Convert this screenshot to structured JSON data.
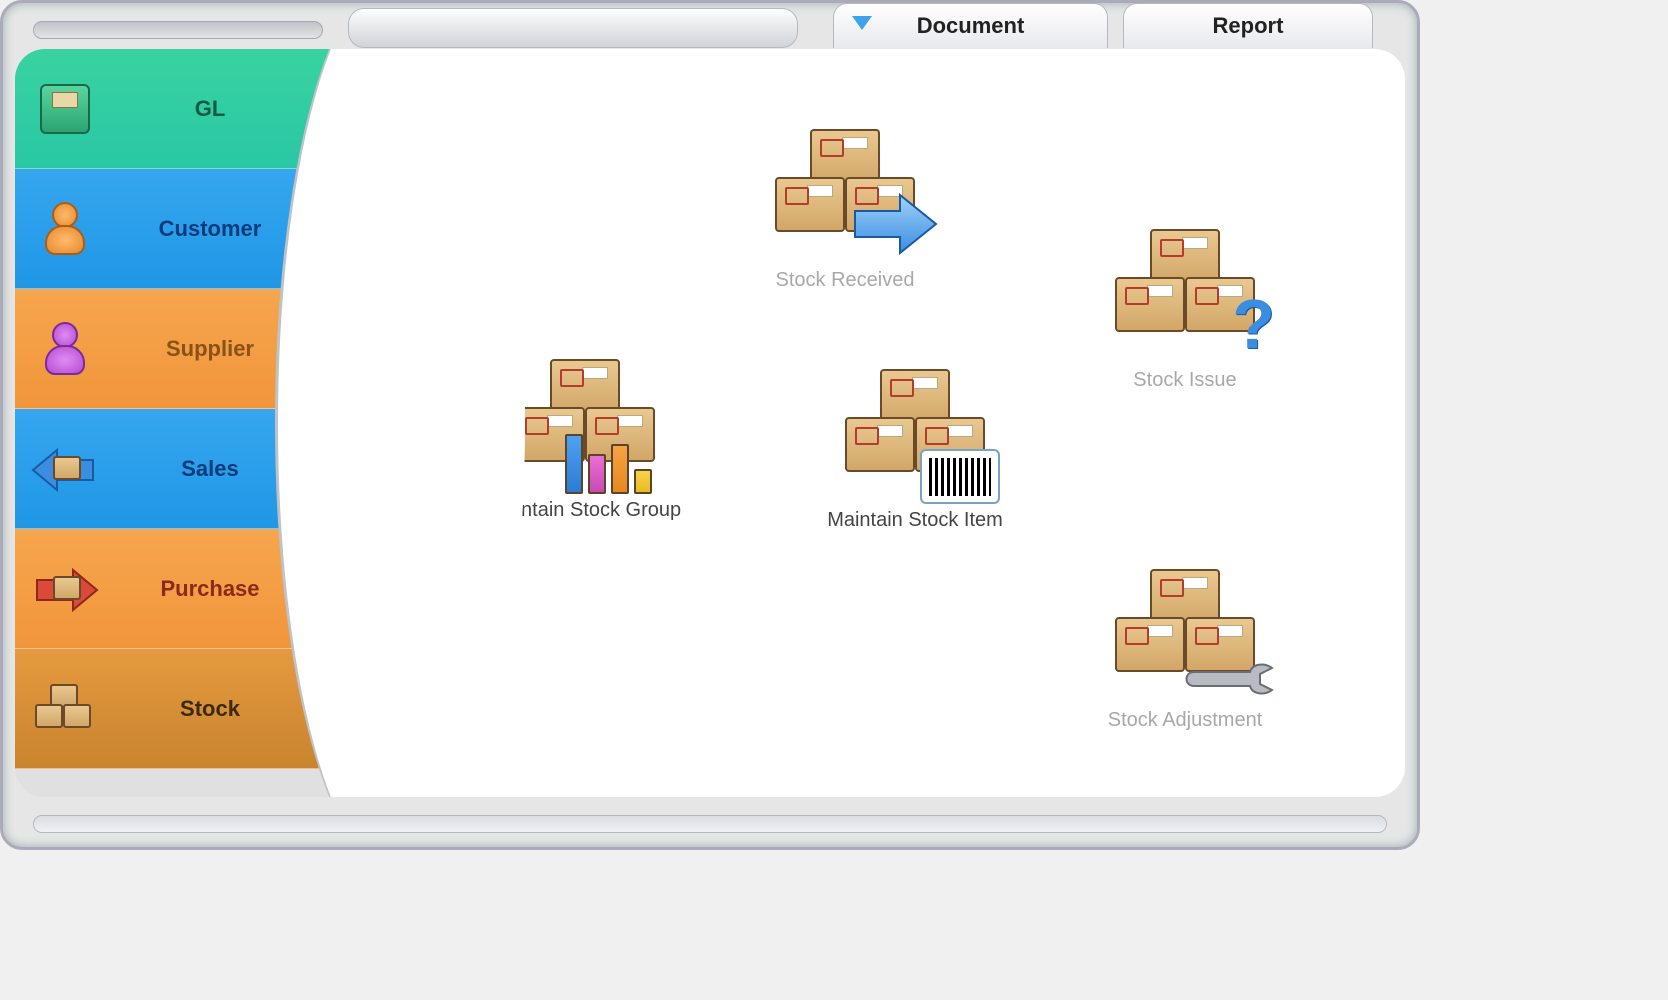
{
  "tabs": {
    "document": "Document",
    "report": "Report"
  },
  "sidebar": {
    "items": [
      {
        "label": "GL"
      },
      {
        "label": "Customer"
      },
      {
        "label": "Supplier"
      },
      {
        "label": "Sales"
      },
      {
        "label": "Purchase"
      },
      {
        "label": "Stock"
      }
    ]
  },
  "content": {
    "stock_received": "Stock Received",
    "stock_issue": "Stock Issue",
    "maintain_group": "Maintain Stock Group",
    "maintain_item": "Maintain Stock Item",
    "stock_adjustment": "Stock Adjustment"
  }
}
